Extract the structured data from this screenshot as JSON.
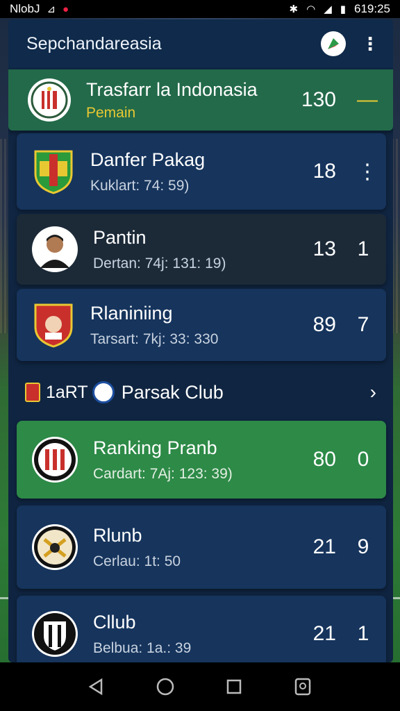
{
  "status_bar": {
    "left_text": "NlobJ",
    "time": "619:25"
  },
  "appbar": {
    "title": "Sepchandareasia"
  },
  "header_row": {
    "name": "Trasfarr la Indonasia",
    "sub": "Pemain",
    "score": "130",
    "trail": "—"
  },
  "rows": [
    {
      "name": "Danfer Pakag",
      "sub": "Kuklart: 74: 59)",
      "a": "18",
      "b": "⋮"
    },
    {
      "name": "Pantin",
      "sub": "Dertan: 74j: 131: 19)",
      "a": "13",
      "b": "1"
    },
    {
      "name": "Rlaniniing",
      "sub": "Tarsart: 7kj: 33: 330",
      "a": "89",
      "b": "7"
    }
  ],
  "section": {
    "prefix": "1aRT",
    "title": "Parsak Club"
  },
  "club_rows": [
    {
      "name": "Ranking Pranb",
      "sub": "Cardart: 7Aj: 123: 39)",
      "a": "80",
      "b": "0"
    },
    {
      "name": "Rlunb",
      "sub": "Cerlau: 1t: 50",
      "a": "21",
      "b": "9"
    },
    {
      "name": "Cllub",
      "sub": "Belbua: 1a.: 39",
      "a": "21",
      "b": "1"
    }
  ],
  "colors": {
    "panel": "#102642",
    "row": "#16345c",
    "row_dark": "#1c2a38",
    "header_green": "#236a4a",
    "highlight_green": "#2d8a47",
    "accent_yellow": "#e8c832"
  }
}
